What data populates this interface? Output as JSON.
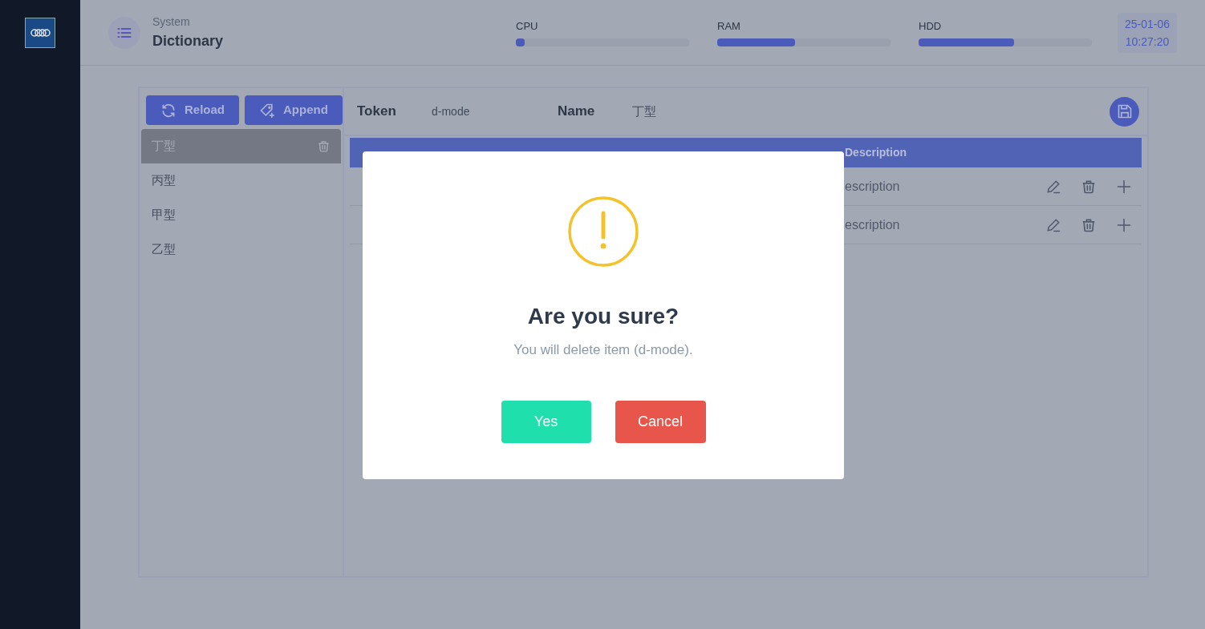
{
  "header": {
    "subtitle": "System",
    "title": "Dictionary",
    "meters": [
      {
        "label": "CPU",
        "level": 0.05
      },
      {
        "label": "RAM",
        "level": 0.45
      },
      {
        "label": "HDD",
        "level": 0.55
      }
    ],
    "date": "25-01-06",
    "time": "10:27:20"
  },
  "toolbar": {
    "buttons": [
      {
        "label": "Reload"
      },
      {
        "label": "Append"
      }
    ]
  },
  "list": [
    {
      "label": "丁型",
      "selected": true
    },
    {
      "label": "丙型",
      "selected": false
    },
    {
      "label": "甲型",
      "selected": false
    },
    {
      "label": "乙型",
      "selected": false
    }
  ],
  "detail": {
    "token_label": "Token",
    "token": "d-mode",
    "name_label": "Name",
    "name": "丁型"
  },
  "table": {
    "columns": [
      "Description"
    ],
    "rows": [
      {
        "description": "escription"
      },
      {
        "description": "escription"
      }
    ]
  },
  "dialog": {
    "title": "Are you sure?",
    "message": "You will delete item (d-mode).",
    "confirm": "Yes",
    "cancel": "Cancel"
  }
}
